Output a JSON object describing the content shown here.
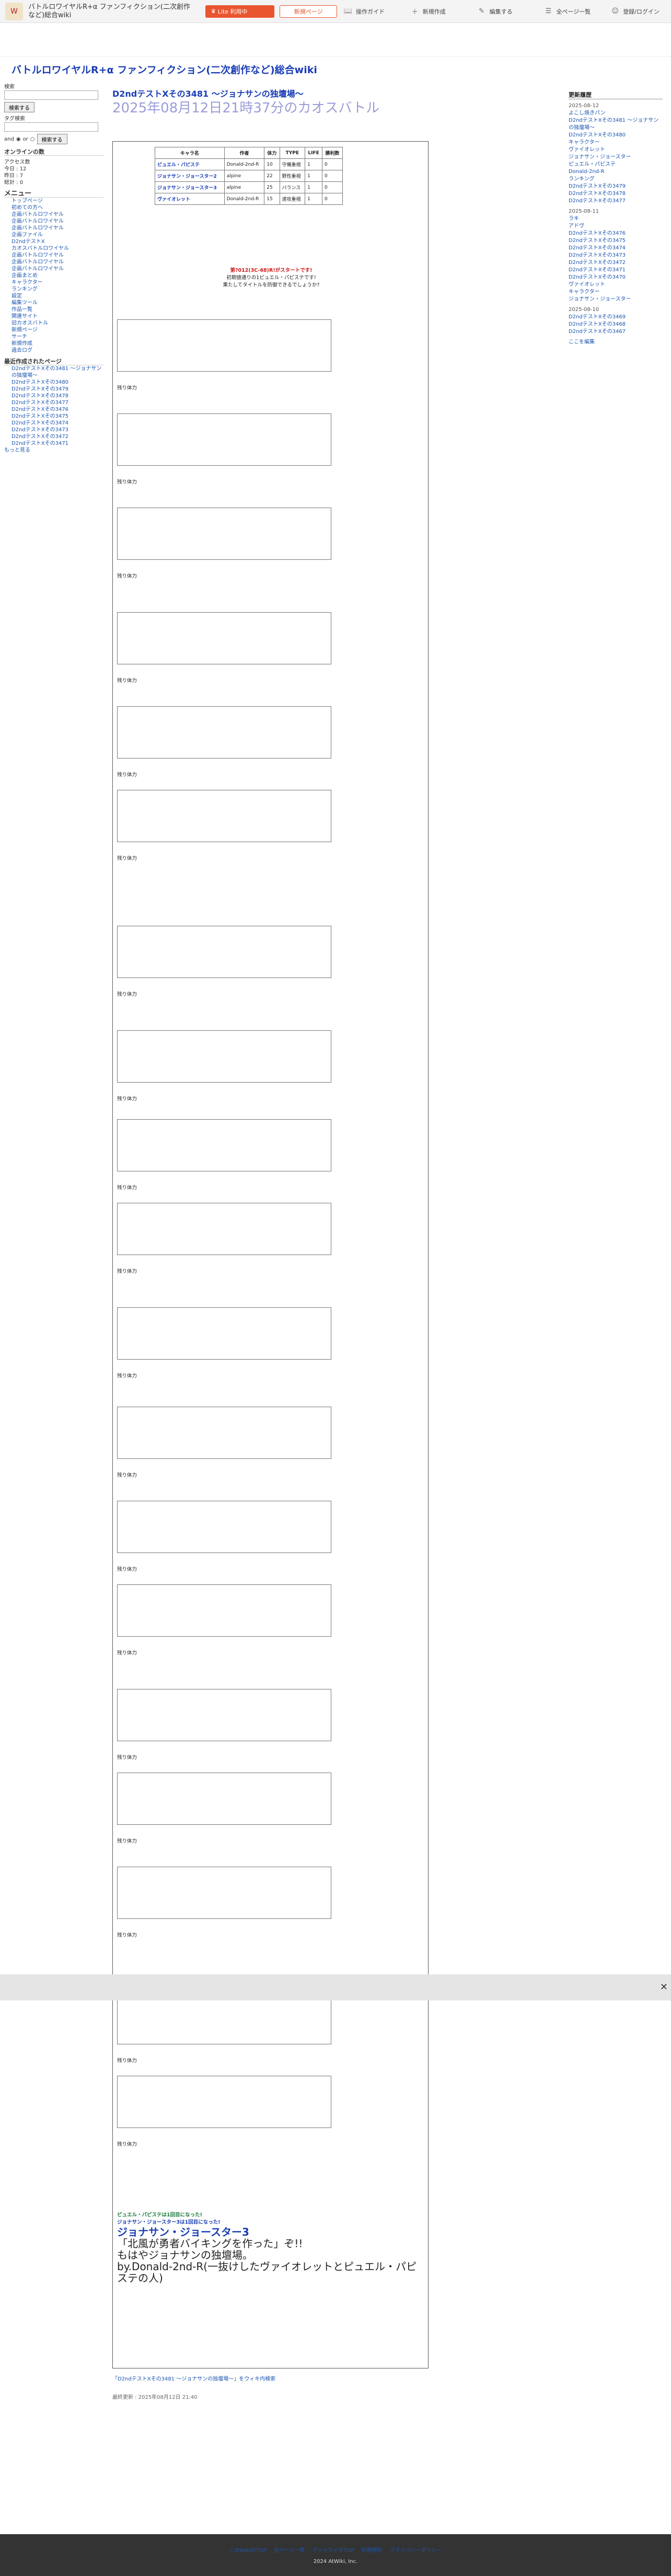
{
  "site": {
    "name_line1": "バトルロワイヤルR+α ファンフィクション(二次創作",
    "name_line2": "など)総合wiki",
    "vip_label": "Lite 利用中",
    "pro_label": "Lite 利用中"
  },
  "topmenu": [
    "新規ページ",
    "操作ガイド",
    "新規作成",
    "編集する",
    "全ページ一覧",
    "登録/ログイン"
  ],
  "title": "バトルロワイヤルR+α ファンフィクション(二次創作など)総合wiki",
  "page": {
    "h1": "D2ndテストXその3481 〜ジョナサンの独壇場〜",
    "subtitle": "2025年08月12日21時37分のカオスバトル"
  },
  "left": {
    "search_label": "検索",
    "search_btn": "検索する",
    "tag_label": "タグ検索",
    "tag_btn": "検索する",
    "and": "and",
    "or": "or",
    "online": "オンラインの数",
    "access_title": "アクセス数",
    "today": "今日 : 12",
    "yesterday": "昨日 : 7",
    "total": "総計 : 0",
    "menu": "メニュー",
    "items": [
      "トップページ",
      "初めての方へ",
      "企画バトルロワイヤル",
      "企画バトルロワイヤル",
      "企画バトルロワイヤル",
      "企画ファイル",
      "D2ndテストX",
      "カオスバトルロワイヤル",
      "企画バトルロワイヤル",
      "企画バトルロワイヤル",
      "企画バトルロワイヤル",
      "企画まとめ",
      "キャラクター",
      "ランキング",
      "設定",
      "編集ツール",
      "作品一覧",
      "関連サイト",
      "旧カオスバトル",
      "新規ページ",
      "サーチ",
      "新規作成",
      "過去ログ"
    ],
    "recent": "最近作成されたページ",
    "recent_items": [
      "D2ndテストXその3481 〜ジョナサンの独壇場〜",
      "D2ndテストXその3480",
      "D2ndテストXその3479",
      "D2ndテストXその3478",
      "D2ndテストXその3477",
      "D2ndテストXその3476",
      "D2ndテストXその3475",
      "D2ndテストXその3474",
      "D2ndテストXその3473",
      "D2ndテストXその3472",
      "D2ndテストXその3471"
    ],
    "more": "もっと見る"
  },
  "right": {
    "title": "更新履歴",
    "date1": "2025-08-12",
    "date2": "2025-08-11",
    "date3": "2025-08-10",
    "items1": [
      "よこし焼きパン",
      "D2ndテストXその3481 〜ジョナサンの独壇場〜",
      "D2ndテストXその3480",
      "キャラクター",
      "ヴァイオレット",
      "ジョナサン・ジョースター",
      "ピュエル・パピステ",
      "Donald-2nd-R",
      "ランキング",
      "D2ndテストXその3479",
      "D2ndテストXその3478",
      "D2ndテストXその3477"
    ],
    "items2": [
      "ラキ",
      "アドヴ",
      "D2ndテストXその3476",
      "D2ndテストXその3475",
      "D2ndテストXその3474",
      "D2ndテストXその3473",
      "D2ndテストXその3472",
      "D2ndテストXその3471",
      "D2ndテストXその3470",
      "ヴァイオレット",
      "キャラクター",
      "ジョナサン・ジョースター"
    ],
    "items3": [
      "D2ndテストXその3469",
      "D2ndテストXその3468",
      "D2ndテストXその3467"
    ],
    "more": "ここを編集"
  },
  "battle": {
    "table_head": [
      "キャラ名",
      "作者",
      "体力",
      "TYPE",
      "LIFE",
      "勝利数"
    ],
    "rows": [
      [
        "ピュエル・パピステ",
        "Donald-2nd-R",
        "10",
        "守備重視",
        "1",
        "0"
      ],
      [
        "ジョナサン・ジョースター2",
        "alpine",
        "22",
        "野性重視",
        "1",
        "0"
      ],
      [
        "ジョナサン・ジョースター3",
        "alpine",
        "25",
        "バランス",
        "1",
        "0"
      ],
      [
        "ヴァイオレット",
        "Donald-2nd-R",
        "15",
        "速攻重視",
        "1",
        "0"
      ]
    ],
    "start": "第?012(3C-68)R!がスタートです!",
    "start2": "初期値通りの1ピュエル・パピステです!",
    "start3": "果たしてタイトルを防御できるでしょうか?",
    "remain": "残り体力",
    "end1": "ピュエル・パピステは1回目になった!",
    "end2": "ジョナサン・ジョースター3は1回目になった!",
    "end3": "ジョナサン・ジョースター3",
    "end4": "「北風が勇者バイキングを作った」ぞ!!",
    "end5": "もはやジョナサンの独壇場。",
    "end6": "by.Donald-2nd-R(一抜けしたヴァイオレットとピュエル・パピステの人)"
  },
  "footer": {
    "links": [
      "このWikiのTOP",
      "全ページ一覧",
      "アットウィキTOP",
      "利用規約",
      "プライバシーポリシー"
    ],
    "copy": "2024 AtWiki, Inc."
  },
  "page_footer": {
    "link": "「D2ndテストXその3481 〜ジョナサンの独壇場〜」をウィキ内検索",
    "updated": "最終更新 : 2025年08月12日 21:40"
  }
}
